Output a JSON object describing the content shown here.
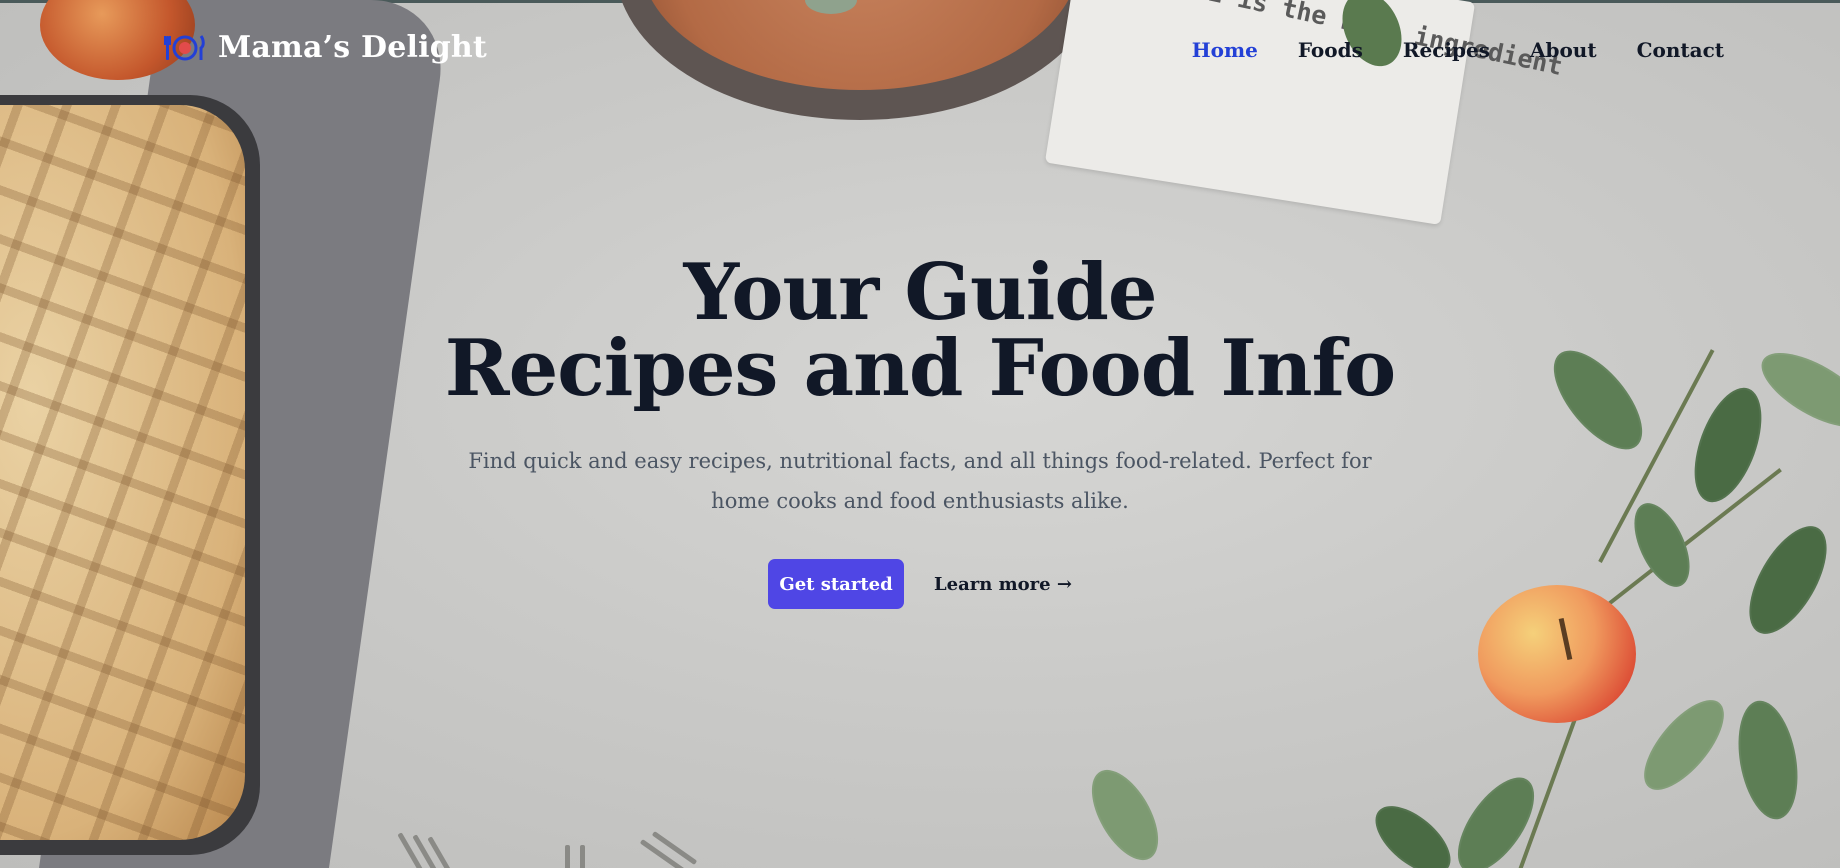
{
  "brand": {
    "name": "Mama’s Delight",
    "icon": "plate-fork-knife-icon",
    "icon_color": "#2340d6"
  },
  "nav": {
    "items": [
      {
        "label": "Home",
        "active": true
      },
      {
        "label": "Foods",
        "active": false
      },
      {
        "label": "Recipes",
        "active": false
      },
      {
        "label": "About",
        "active": false
      },
      {
        "label": "Contact",
        "active": false
      }
    ],
    "active_color": "#2340d6"
  },
  "hero": {
    "title_line1": "Your Guide",
    "title_line2": "Recipes and Food Info",
    "subtitle": "Find quick and easy recipes, nutritional facts, and all things food-related. Perfect for home cooks and food enthusiasts alike.",
    "primary_cta": "Get started",
    "secondary_cta": "Learn more →"
  },
  "background": {
    "napkin_text": "LOVE is the best ingredient"
  },
  "colors": {
    "primary_button": "#4f46e5",
    "heading": "#111827",
    "body_text": "#4b5563"
  }
}
